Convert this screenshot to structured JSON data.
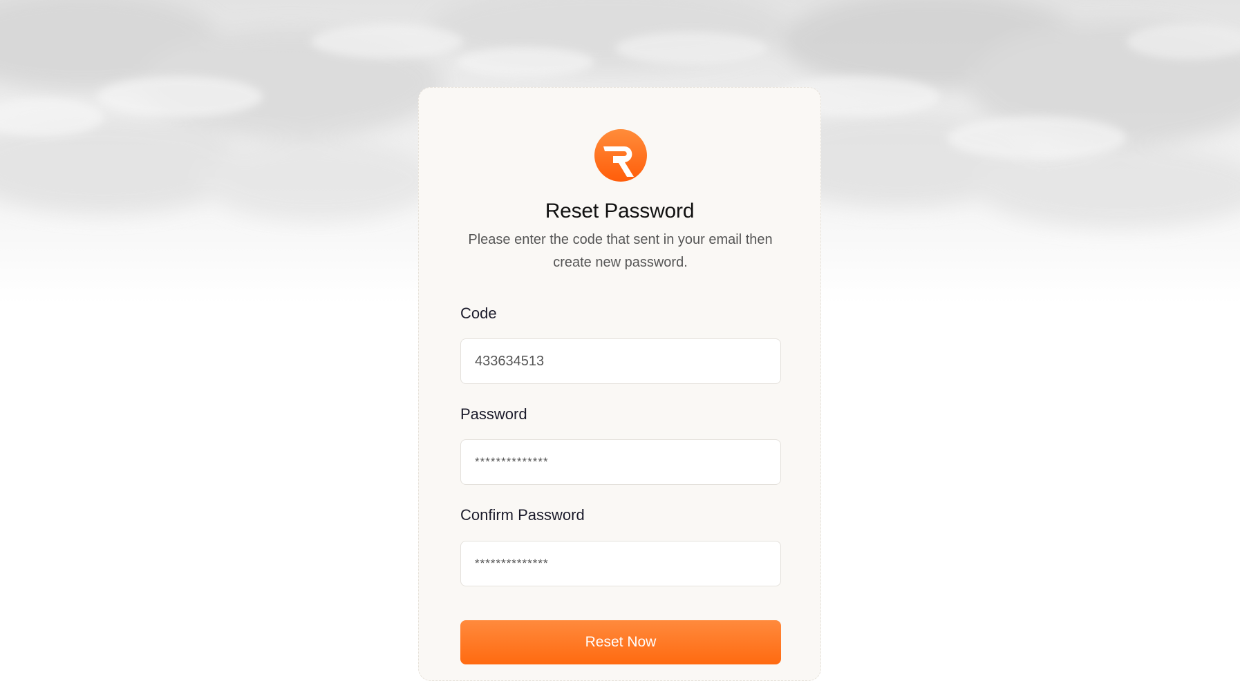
{
  "colors": {
    "accent": "#ff6a10",
    "card_bg": "#faf8f5",
    "text_primary": "#111111",
    "text_secondary": "#555555"
  },
  "brand": {
    "logo_icon": "r-logo-icon"
  },
  "form": {
    "title": "Reset Password",
    "subtitle": "Please enter the code that sent in your email then create new password.",
    "code": {
      "label": "Code",
      "value": "433634513"
    },
    "password": {
      "label": "Password",
      "value": "**************"
    },
    "confirm_password": {
      "label": "Confirm Password",
      "value": "**************"
    },
    "submit_label": "Reset Now"
  }
}
